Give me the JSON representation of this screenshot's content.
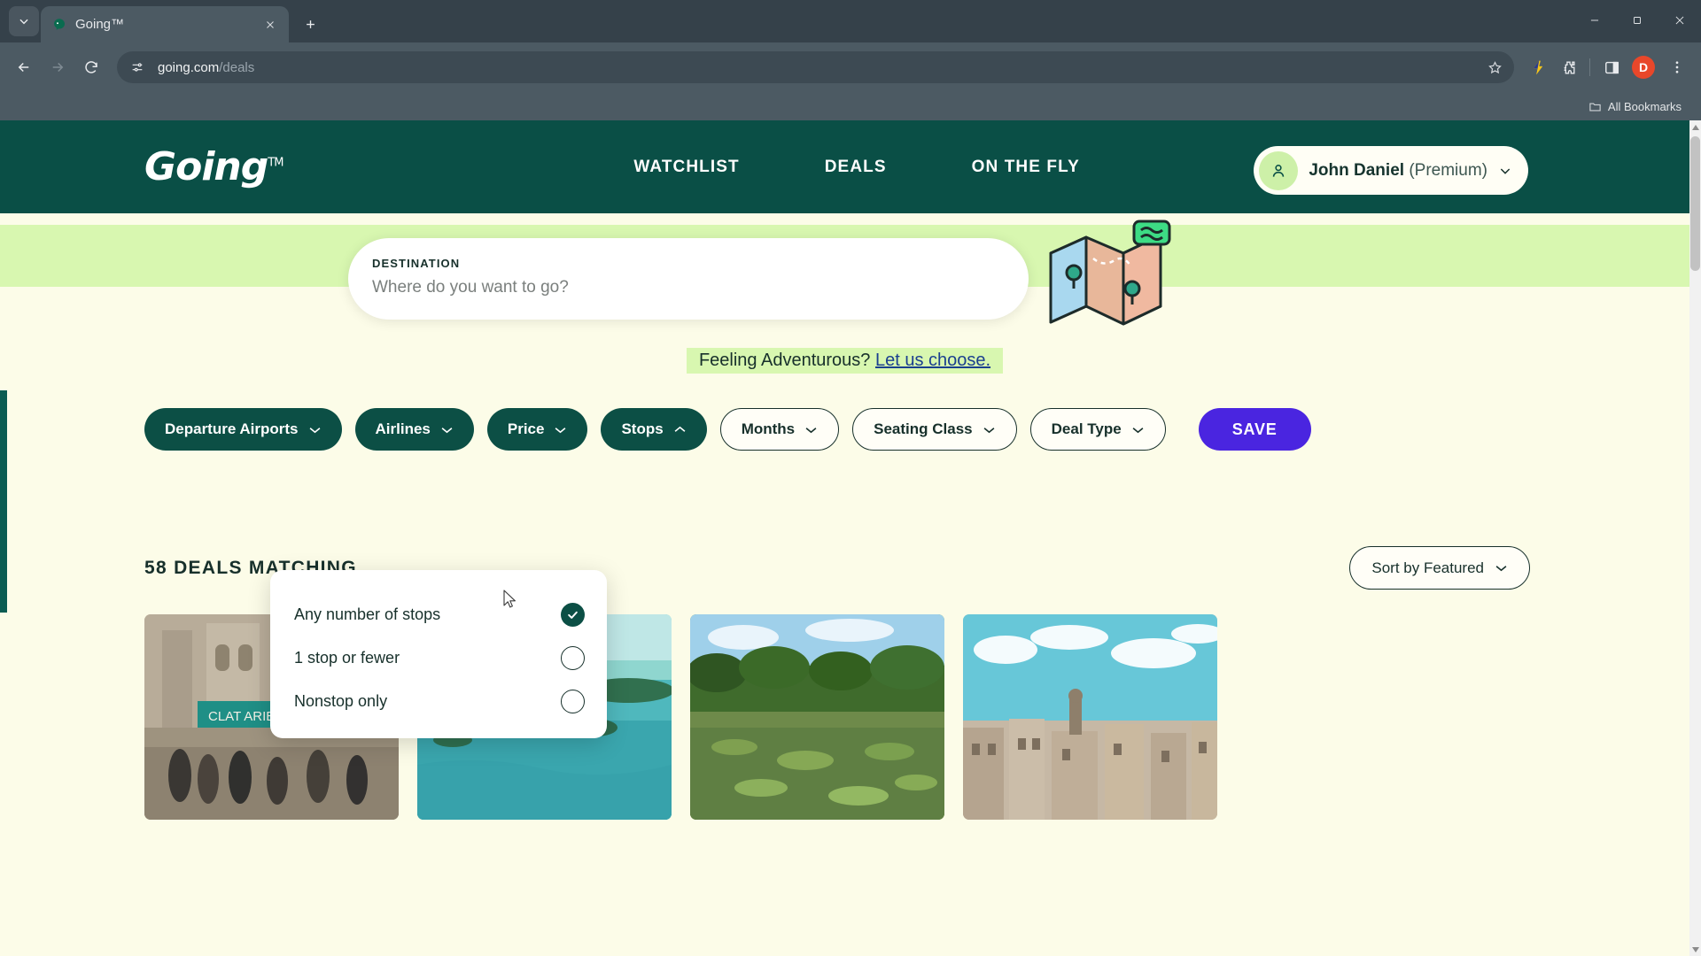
{
  "browser": {
    "tab": {
      "title": "Going™",
      "favicon_icon": "going-favicon"
    },
    "tab_list_icon": "chevron-down-icon",
    "new_tab_icon": "plus-icon",
    "close_tab_icon": "close-icon",
    "nav": {
      "back_icon": "back-arrow-icon",
      "forward_icon": "forward-arrow-icon",
      "reload_icon": "reload-icon"
    },
    "omnibox": {
      "site_settings_icon": "page-settings-icon",
      "url_domain": "going.com",
      "url_path": "/deals",
      "bookmark_star_icon": "star-icon"
    },
    "toolbar_icons": [
      "lightning-extension-icon",
      "extensions-puzzle-icon",
      "side-panel-icon"
    ],
    "profile": {
      "initial": "D",
      "color": "#e8472a"
    },
    "menu_icon": "three-dot-menu-icon",
    "window": {
      "minimize_icon": "minimize-icon",
      "maximize_icon": "restore-icon",
      "close_icon": "window-close-icon"
    },
    "bookmarks_bar": {
      "folder_icon": "folder-icon",
      "label": "All Bookmarks"
    }
  },
  "site": {
    "logo": {
      "text": "Going",
      "tm": "TM"
    },
    "nav_links": [
      {
        "label": "WATCHLIST"
      },
      {
        "label": "DEALS"
      },
      {
        "label": "ON THE FLY"
      }
    ],
    "user": {
      "avatar_icon": "person-icon",
      "name": "John Daniel",
      "tier": "(Premium)",
      "chevron_icon": "chevron-down-icon"
    },
    "search": {
      "label": "DESTINATION",
      "placeholder": "Where do you want to go?"
    },
    "adventurous": {
      "text": "Feeling Adventurous? ",
      "link": "Let us choose."
    },
    "filters": [
      {
        "label": "Departure Airports",
        "style": "solid",
        "chevron": "chevron-down-icon"
      },
      {
        "label": "Airlines",
        "style": "solid",
        "chevron": "chevron-down-icon"
      },
      {
        "label": "Price",
        "style": "solid",
        "chevron": "chevron-down-icon"
      },
      {
        "label": "Stops",
        "style": "solid",
        "chevron": "chevron-up-icon"
      },
      {
        "label": "Months",
        "style": "outline",
        "chevron": "chevron-down-icon"
      },
      {
        "label": "Seating Class",
        "style": "outline",
        "chevron": "chevron-down-icon"
      },
      {
        "label": "Deal Type",
        "style": "outline",
        "chevron": "chevron-down-icon"
      }
    ],
    "save_button": "SAVE",
    "results": {
      "count_text": "58 DEALS MATCHING",
      "sort": {
        "label": "Sort by Featured",
        "chevron": "chevron-down-icon"
      }
    },
    "stops_dropdown": {
      "options": [
        {
          "label": "Any number of stops",
          "selected": true
        },
        {
          "label": "1 stop or fewer",
          "selected": false
        },
        {
          "label": "Nonstop only",
          "selected": false
        }
      ],
      "check_icon": "check-icon"
    },
    "deal_cards": [
      {
        "name": "european-street-scene"
      },
      {
        "name": "tropical-island-bay"
      },
      {
        "name": "lily-pond-jungle"
      },
      {
        "name": "city-rooftops-skyline"
      }
    ],
    "colors": {
      "brand_dark": "#0a4f46",
      "band_green": "#d8f7b0",
      "page_bg": "#fcfce8",
      "save_purple": "#4a25e0"
    }
  }
}
